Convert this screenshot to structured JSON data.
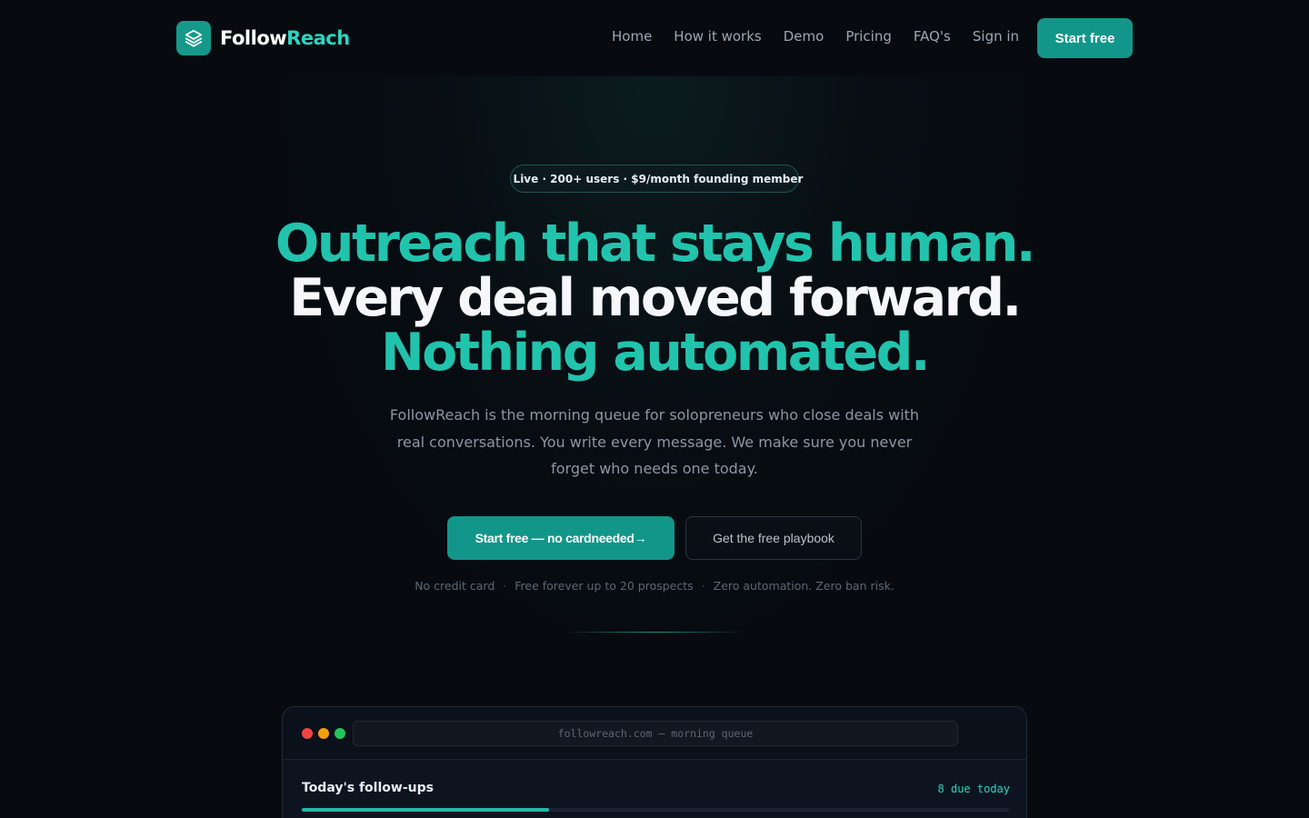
{
  "brand": {
    "name_part1": "Follow",
    "name_part2": "Reach",
    "accent": "#2dd4bf",
    "primary": "#13968a",
    "icon": "layers-icon"
  },
  "nav": {
    "links": [
      "Home",
      "How it works",
      "Demo",
      "Pricing",
      "FAQ's",
      "Sign in"
    ],
    "cta": "Start free"
  },
  "hero": {
    "badge": "Live · 200+ users · $9/month founding member",
    "headline_line1": "Outreach that stays human.",
    "headline_line2": "Every deal moved forward.",
    "headline_line3": "Nothing automated.",
    "subtitle": "FollowReach is the morning queue for solopreneurs who close deals with real conversations. You write every message. We make sure you never forget who needs one today.",
    "primary_cta": "Start free — no cardneeded→",
    "secondary_cta": "Get the free playbook",
    "notes": [
      "No credit card",
      "Free forever up to 20 prospects",
      "Zero automation. Zero ban risk."
    ]
  },
  "preview": {
    "url": "followreach.com — morning queue",
    "panel_title": "Today's follow-ups",
    "due_label": "8 due today",
    "progress_fraction": 0.35
  }
}
